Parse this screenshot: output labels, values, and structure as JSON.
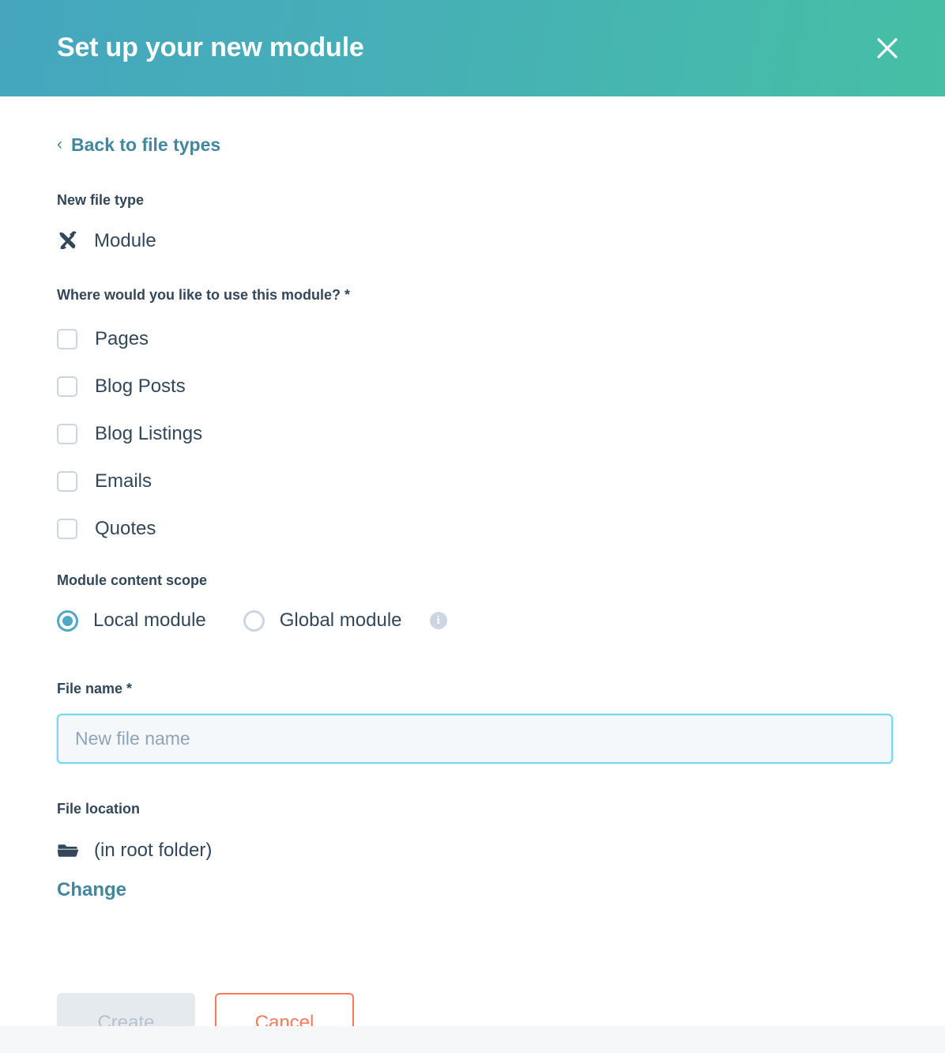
{
  "header": {
    "title": "Set up your new module",
    "close_label": "Close",
    "gradient_start": "#45a6be",
    "gradient_end": "#46bfa5"
  },
  "back_link": {
    "chevron": "‹",
    "label": "Back to file types"
  },
  "new_file_type": {
    "label": "New file type",
    "icon": "module-tools-icon",
    "value": "Module"
  },
  "usage": {
    "label": "Where would you like to use this module? *",
    "options": [
      {
        "label": "Pages",
        "checked": false
      },
      {
        "label": "Blog Posts",
        "checked": false
      },
      {
        "label": "Blog Listings",
        "checked": false
      },
      {
        "label": "Emails",
        "checked": false
      },
      {
        "label": "Quotes",
        "checked": false
      }
    ]
  },
  "scope": {
    "label": "Module content scope",
    "options": [
      {
        "label": "Local module",
        "selected": true
      },
      {
        "label": "Global module",
        "selected": false
      }
    ],
    "info_glyph": "i"
  },
  "file_name": {
    "label": "File name *",
    "value": "",
    "placeholder": "New file name"
  },
  "file_location": {
    "label": "File location",
    "icon": "folder-icon",
    "value": "(in root folder)",
    "change_label": "Change"
  },
  "footer": {
    "create_label": "Create",
    "create_disabled": true,
    "cancel_label": "Cancel",
    "cancel_color": "#ff7a59"
  }
}
